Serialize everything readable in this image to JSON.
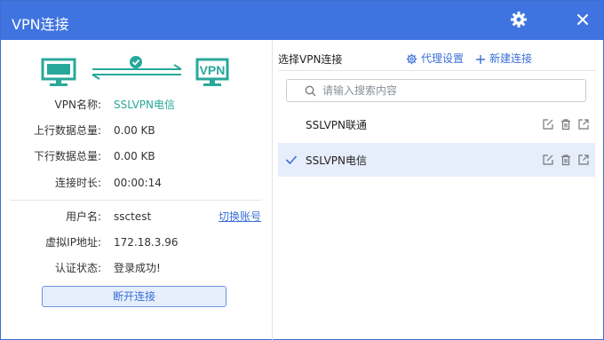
{
  "window": {
    "title": "VPN连接"
  },
  "status": {
    "vpn_name_label": "VPN名称:",
    "vpn_name": "SSLVPN电信",
    "upload_label": "上行数据总量:",
    "upload": "0.00 KB",
    "download_label": "下行数据总量:",
    "download": "0.00 KB",
    "duration_label": "连接时长:",
    "duration": "00:00:14",
    "username_label": "用户名:",
    "username": "ssctest",
    "switch_account": "切换账号",
    "ip_label": "虚拟IP地址:",
    "ip": "172.18.3.96",
    "auth_label": "认证状态:",
    "auth": "登录成功!",
    "disconnect": "断开连接",
    "badge_text": "VPN"
  },
  "connections": {
    "title": "选择VPN连接",
    "proxy_settings": "代理设置",
    "new_connection": "新建连接",
    "search_placeholder": "请输入搜索内容",
    "items": [
      {
        "name": "SSLVPN联通",
        "selected": false
      },
      {
        "name": "SSLVPN电信",
        "selected": true
      }
    ]
  },
  "colors": {
    "titlebar": "#3f74e0",
    "accent": "#28a89a",
    "link": "#3b6fd6",
    "selected_row": "#e6edfb"
  }
}
